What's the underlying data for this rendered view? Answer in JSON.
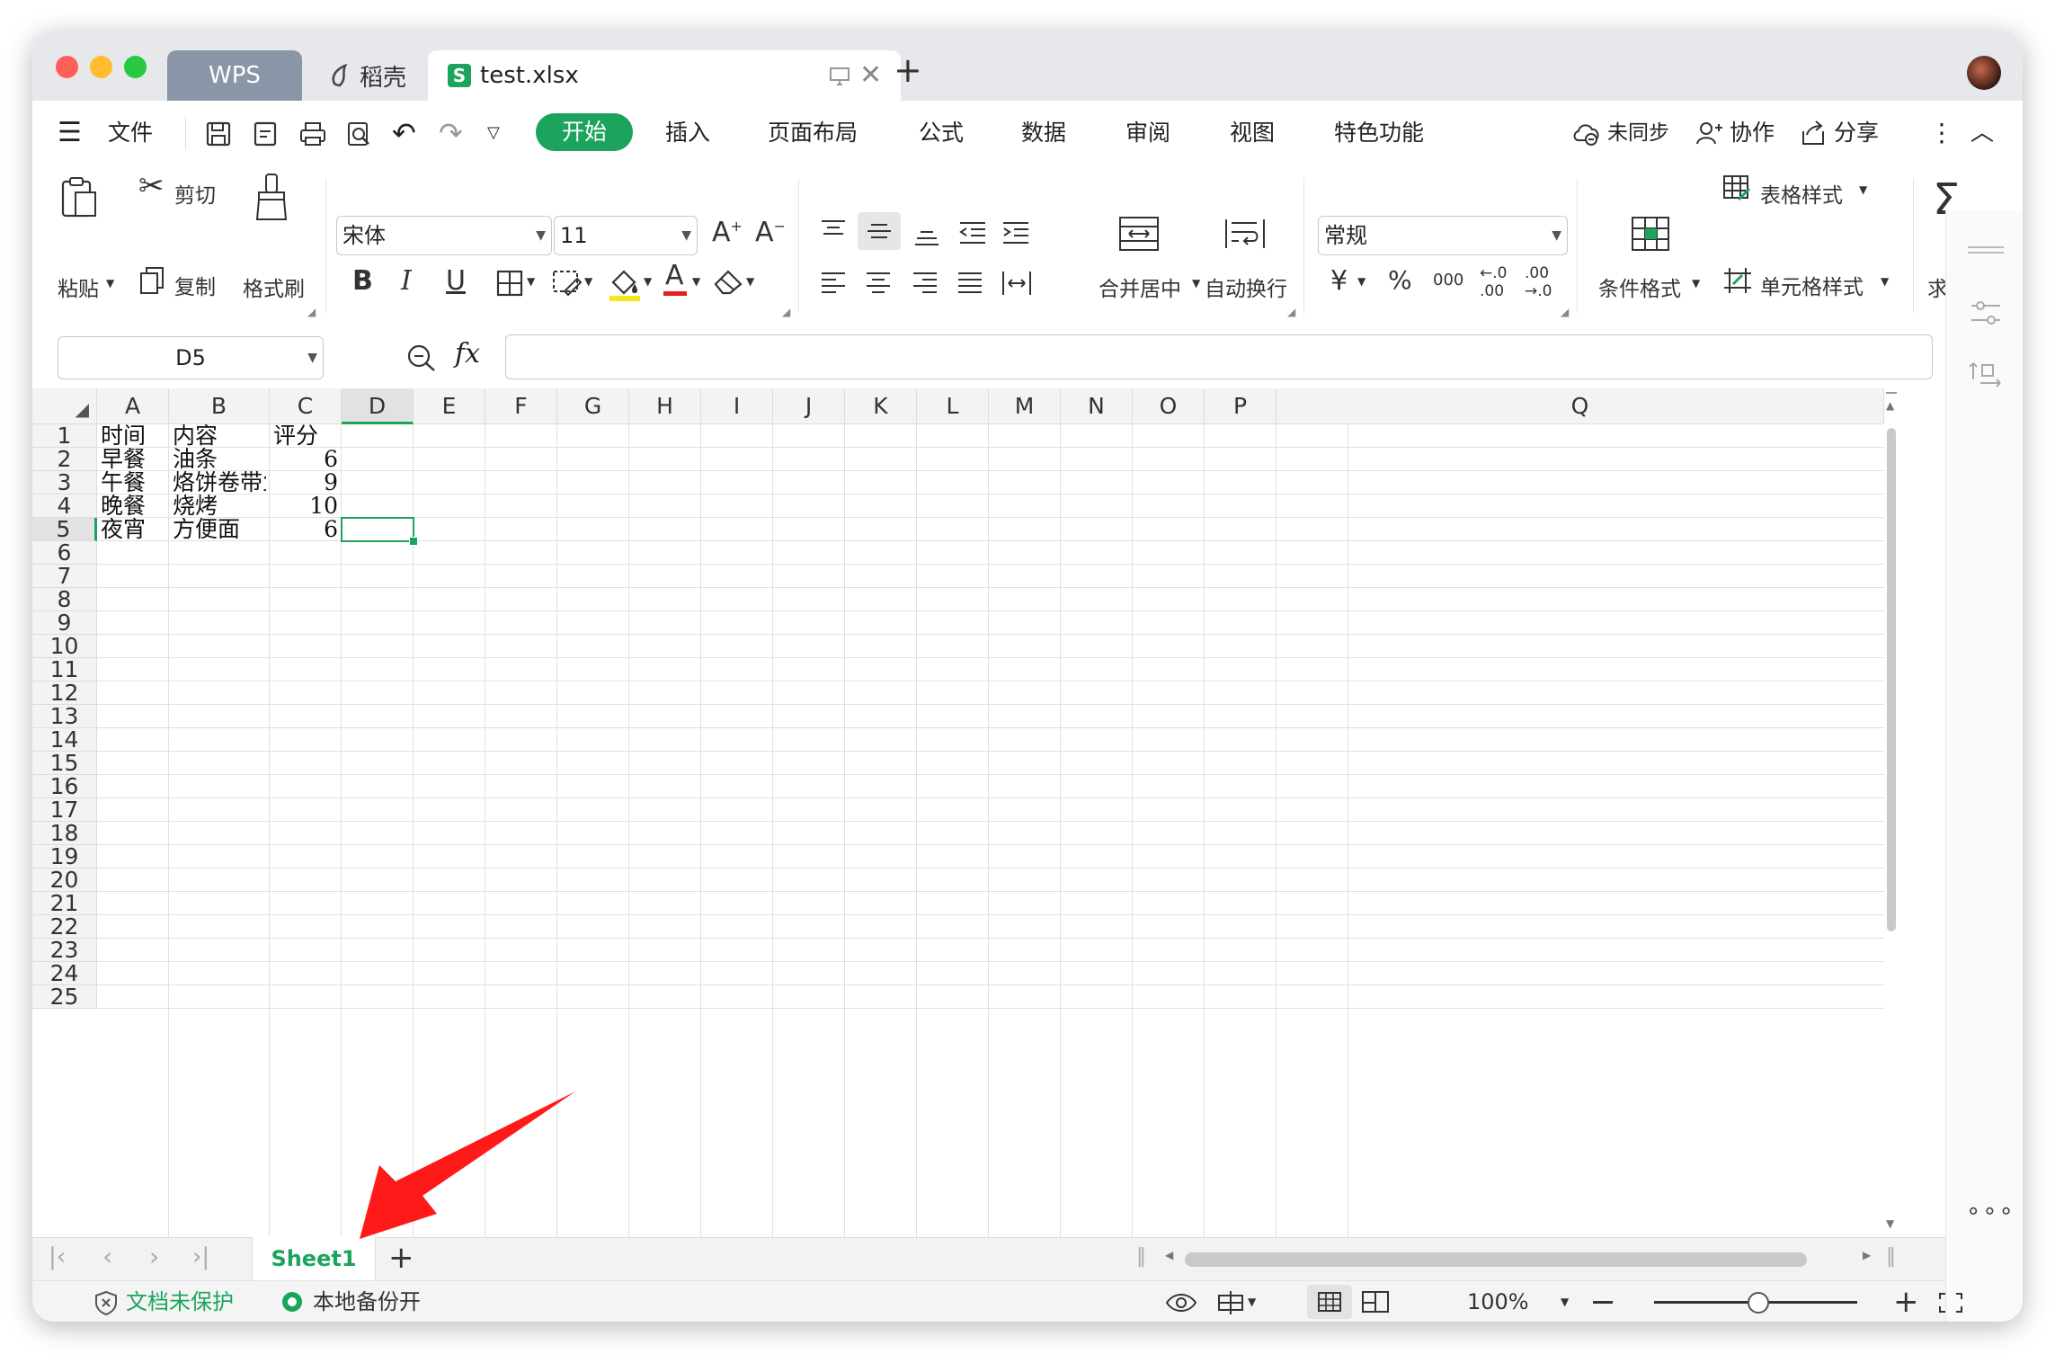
{
  "tabs": [
    {
      "label": "WPS"
    },
    {
      "label": "稻壳"
    },
    {
      "label": "test.xlsx"
    }
  ],
  "menu": {
    "file": "文件",
    "items": [
      "开始",
      "插入",
      "页面布局",
      "公式",
      "数据",
      "审阅",
      "视图",
      "特色功能"
    ],
    "sync": "未同步",
    "collab": "协作",
    "share": "分享"
  },
  "ribbon": {
    "paste": "粘贴",
    "cut": "剪切",
    "copy": "复制",
    "format_painter": "格式刷",
    "font_name": "宋体",
    "font_size": "11",
    "merge_center": "合并居中",
    "wrap_text": "自动换行",
    "number_format": "常规",
    "conditional_format": "条件格式",
    "table_style": "表格样式",
    "cell_style": "单元格样式",
    "sum": "求和"
  },
  "formula_bar": {
    "name_box": "D5",
    "fx": "fx",
    "value": ""
  },
  "grid": {
    "columns": [
      "A",
      "B",
      "C",
      "D",
      "E",
      "F",
      "G",
      "H",
      "I",
      "J",
      "K",
      "L",
      "M",
      "N",
      "O",
      "P",
      "Q"
    ],
    "rows": [
      "1",
      "2",
      "3",
      "4",
      "5",
      "6",
      "7",
      "8",
      "9",
      "10",
      "11",
      "12",
      "13",
      "14",
      "15",
      "16",
      "17",
      "18",
      "19",
      "20",
      "21",
      "22",
      "23",
      "24",
      "25"
    ],
    "active_cell": "D5",
    "data": [
      [
        "时间",
        "内容",
        "评分"
      ],
      [
        "早餐",
        "油条",
        "6"
      ],
      [
        "午餐",
        "烙饼卷带鱼",
        "9"
      ],
      [
        "晚餐",
        "烧烤",
        "10"
      ],
      [
        "夜宵",
        "方便面",
        "6"
      ]
    ]
  },
  "sheet_tabs": {
    "active": "Sheet1",
    "add": "+"
  },
  "status": {
    "protect": "文档未保护",
    "backup": "本地备份开",
    "zoom": "100%"
  },
  "colors": {
    "accent": "#1ca35c",
    "active_tab": "#ffffff",
    "wps_tab": "#8b95a8",
    "arrow": "#ff1a1a"
  }
}
